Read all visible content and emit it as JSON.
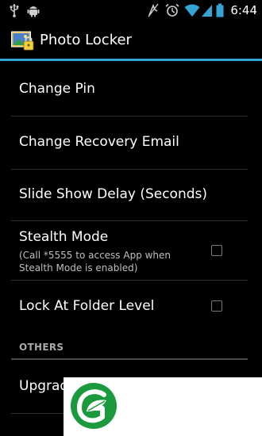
{
  "status_bar": {
    "time": "6:44",
    "icons": [
      "usb-icon",
      "android-debug-icon",
      "muted-icon",
      "alarm-icon",
      "wifi-icon",
      "signal-icon",
      "battery-icon"
    ]
  },
  "action_bar": {
    "title": "Photo Locker",
    "accent_color": "#34a4d4"
  },
  "preferences": {
    "change_pin": {
      "title": "Change Pin"
    },
    "change_recovery_email": {
      "title": "Change Recovery Email"
    },
    "slide_show_delay": {
      "title": "Slide Show Delay (Seconds)"
    },
    "stealth_mode": {
      "title": "Stealth Mode",
      "summary": "(Call *5555 to access App when Stealth Mode is enabled)",
      "checked": false
    },
    "lock_at_folder_level": {
      "title": "Lock At Folder Level",
      "checked": false
    }
  },
  "others_category": {
    "header": "OTHERS",
    "upgrade": {
      "title": "Upgrade"
    }
  },
  "overlay": {
    "logo_icon": "green-leaf-g-logo-icon",
    "brand_color": "#1a9a3c"
  }
}
